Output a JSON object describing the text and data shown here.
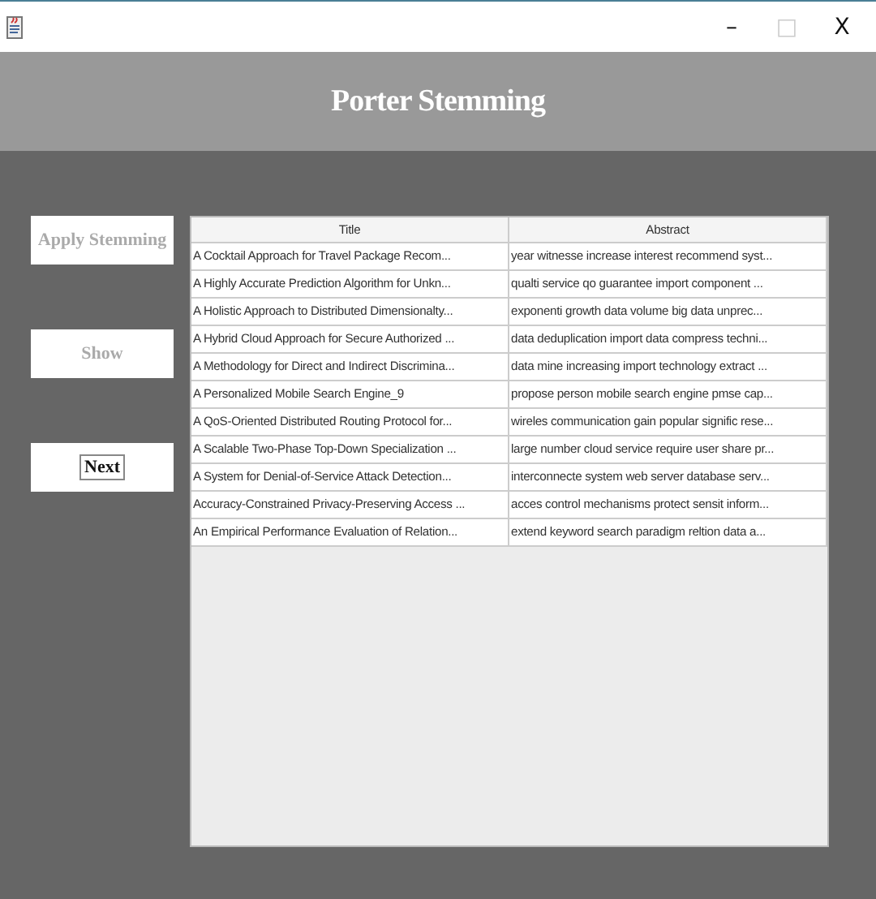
{
  "window": {
    "title_buttons": [
      {
        "label": "–",
        "disabled": false
      },
      {
        "label": "□",
        "disabled": true
      },
      {
        "label": "X",
        "disabled": false
      }
    ]
  },
  "header": {
    "title": "Porter Stemming"
  },
  "buttons": [
    {
      "label": "Apply Stemming",
      "disabled": true,
      "focused": false
    },
    {
      "label": "Show",
      "disabled": true,
      "focused": false
    },
    {
      "label": "Next",
      "disabled": false,
      "focused": true
    }
  ],
  "table": {
    "columns": [
      "Title",
      "Abstract"
    ],
    "rows": [
      [
        "A Cocktail Approach for Travel Package Recom...",
        "year witnesse increase interest recommend syst..."
      ],
      [
        "A Highly Accurate Prediction Algorithm for Unkn...",
        "qualti service qo guarantee import component ..."
      ],
      [
        "A Holistic Approach to Distributed Dimensionalty...",
        "exponenti growth data volume big data unprec..."
      ],
      [
        "A Hybrid Cloud Approach for Secure Authorized ...",
        "data deduplication import data compress techni..."
      ],
      [
        "A Methodology for Direct and Indirect Discrimina...",
        "data mine increasing import technology extract ..."
      ],
      [
        "A Personalized Mobile Search Engine_9",
        "propose person mobile search engine pmse cap..."
      ],
      [
        "A QoS-Oriented Distributed Routing Protocol for...",
        "wireles communication gain popular signific rese..."
      ],
      [
        "A Scalable Two-Phase Top-Down Specialization ...",
        "large number cloud service require user share pr..."
      ],
      [
        "A System for Denial-of-Service Attack Detection...",
        "interconnecte system web server database serv..."
      ],
      [
        "Accuracy-Constrained Privacy-Preserving Access ...",
        "acces control mechanisms protect sensit inform..."
      ],
      [
        "An Empirical Performance Evaluation of Relation...",
        "extend keyword search paradigm reltion data a..."
      ]
    ]
  }
}
